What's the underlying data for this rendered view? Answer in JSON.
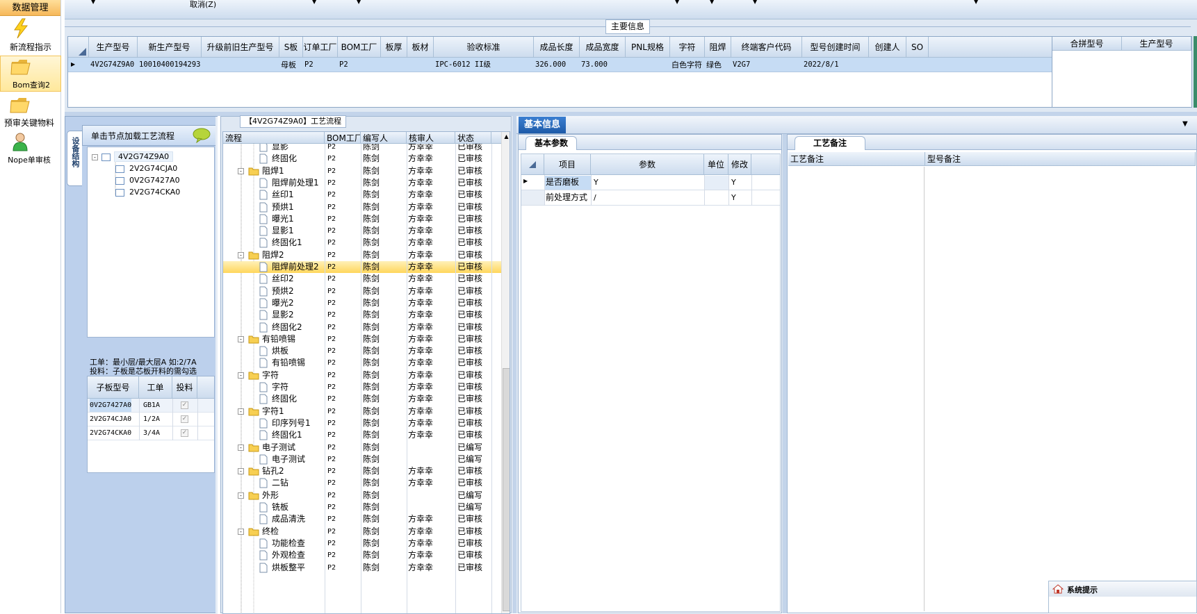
{
  "sidebar": {
    "header": "数据管理",
    "items": [
      {
        "label": "新流程指示",
        "icon": "lightning-icon"
      },
      {
        "label": "Bom查询2",
        "icon": "folder-open-icon"
      },
      {
        "label": "预审关键物料",
        "icon": "folder-open-icon"
      },
      {
        "label": "Nope单审核",
        "icon": "user-icon"
      }
    ]
  },
  "toolbar": {
    "cancel_label": "取消(Z)"
  },
  "main_info": {
    "title": "主要信息",
    "columns": [
      "生产型号",
      "新生产型号",
      "升级前旧生产型号",
      "S板",
      "订单工厂",
      "BOM工厂",
      "板厚",
      "板材",
      "验收标准",
      "成品长度",
      "成品宽度",
      "PNL规格",
      "字符",
      "阻焊",
      "终端客户代码",
      "型号创建时间",
      "创建人",
      "SO"
    ],
    "row": [
      "4V2G74Z9A0",
      "10010400194293",
      "",
      "母板",
      "P2",
      "P2",
      "",
      "",
      "IPC-6012 II级",
      "326.000",
      "73.000",
      "",
      "白色字符",
      "绿色",
      "V2G7",
      "2022/8/1",
      "",
      ""
    ],
    "side_columns": [
      "合拼型号",
      "生产型号"
    ]
  },
  "left_panel": {
    "vertical_tab": "设备结构",
    "hint": "单击节点加载工艺流程",
    "tree_root": "4V2G74Z9A0",
    "tree_children": [
      "2V2G74CJA0",
      "0V2G7427A0",
      "2V2G74CKA0"
    ],
    "note1": "工单：最小层/最大层A 如:2/7A",
    "note2": "投料：子板是芯板开料的需勾选",
    "sub_columns": [
      "子板型号",
      "工单",
      "投料"
    ],
    "sub_rows": [
      {
        "model": "0V2G7427A0",
        "order": "GB1A",
        "feed": "✓"
      },
      {
        "model": "2V2G74CJA0",
        "order": "1/2A",
        "feed": "✓"
      },
      {
        "model": "2V2G74CKA0",
        "order": "3/4A",
        "feed": "✓"
      }
    ]
  },
  "flow": {
    "title": "【4V2G74Z9A0】工艺流程",
    "columns": [
      "流程",
      "BOM工厂",
      "编写人",
      "核审人",
      "状态"
    ],
    "rows": [
      {
        "n": "显影",
        "f": "P2",
        "w": "陈剑",
        "r": "方幸幸",
        "s": "已审核",
        "t": "leaf"
      },
      {
        "n": "终固化",
        "f": "P2",
        "w": "陈剑",
        "r": "方幸幸",
        "s": "已审核",
        "t": "leaf"
      },
      {
        "n": "阻焊1",
        "f": "P2",
        "w": "陈剑",
        "r": "方幸幸",
        "s": "已审核",
        "t": "group"
      },
      {
        "n": "阻焊前处理1",
        "f": "P2",
        "w": "陈剑",
        "r": "方幸幸",
        "s": "已审核",
        "t": "leaf"
      },
      {
        "n": "丝印1",
        "f": "P2",
        "w": "陈剑",
        "r": "方幸幸",
        "s": "已审核",
        "t": "leaf"
      },
      {
        "n": "预烘1",
        "f": "P2",
        "w": "陈剑",
        "r": "方幸幸",
        "s": "已审核",
        "t": "leaf"
      },
      {
        "n": "曝光1",
        "f": "P2",
        "w": "陈剑",
        "r": "方幸幸",
        "s": "已审核",
        "t": "leaf"
      },
      {
        "n": "显影1",
        "f": "P2",
        "w": "陈剑",
        "r": "方幸幸",
        "s": "已审核",
        "t": "leaf"
      },
      {
        "n": "终固化1",
        "f": "P2",
        "w": "陈剑",
        "r": "方幸幸",
        "s": "已审核",
        "t": "leaf"
      },
      {
        "n": "阻焊2",
        "f": "P2",
        "w": "陈剑",
        "r": "方幸幸",
        "s": "已审核",
        "t": "group"
      },
      {
        "n": "阻焊前处理2",
        "f": "P2",
        "w": "陈剑",
        "r": "方幸幸",
        "s": "已审核",
        "t": "leaf",
        "sel": true
      },
      {
        "n": "丝印2",
        "f": "P2",
        "w": "陈剑",
        "r": "方幸幸",
        "s": "已审核",
        "t": "leaf"
      },
      {
        "n": "预烘2",
        "f": "P2",
        "w": "陈剑",
        "r": "方幸幸",
        "s": "已审核",
        "t": "leaf"
      },
      {
        "n": "曝光2",
        "f": "P2",
        "w": "陈剑",
        "r": "方幸幸",
        "s": "已审核",
        "t": "leaf"
      },
      {
        "n": "显影2",
        "f": "P2",
        "w": "陈剑",
        "r": "方幸幸",
        "s": "已审核",
        "t": "leaf"
      },
      {
        "n": "终固化2",
        "f": "P2",
        "w": "陈剑",
        "r": "方幸幸",
        "s": "已审核",
        "t": "leaf"
      },
      {
        "n": "有铅喷锡",
        "f": "P2",
        "w": "陈剑",
        "r": "方幸幸",
        "s": "已审核",
        "t": "group"
      },
      {
        "n": "烘板",
        "f": "P2",
        "w": "陈剑",
        "r": "方幸幸",
        "s": "已审核",
        "t": "leaf"
      },
      {
        "n": "有铅喷锡",
        "f": "P2",
        "w": "陈剑",
        "r": "方幸幸",
        "s": "已审核",
        "t": "leaf"
      },
      {
        "n": "字符",
        "f": "P2",
        "w": "陈剑",
        "r": "方幸幸",
        "s": "已审核",
        "t": "group"
      },
      {
        "n": "字符",
        "f": "P2",
        "w": "陈剑",
        "r": "方幸幸",
        "s": "已审核",
        "t": "leaf"
      },
      {
        "n": "终固化",
        "f": "P2",
        "w": "陈剑",
        "r": "方幸幸",
        "s": "已审核",
        "t": "leaf"
      },
      {
        "n": "字符1",
        "f": "P2",
        "w": "陈剑",
        "r": "方幸幸",
        "s": "已审核",
        "t": "group"
      },
      {
        "n": "印序列号1",
        "f": "P2",
        "w": "陈剑",
        "r": "方幸幸",
        "s": "已审核",
        "t": "leaf"
      },
      {
        "n": "终固化1",
        "f": "P2",
        "w": "陈剑",
        "r": "方幸幸",
        "s": "已审核",
        "t": "leaf"
      },
      {
        "n": "电子测试",
        "f": "P2",
        "w": "陈剑",
        "r": "",
        "s": "已编写",
        "t": "group"
      },
      {
        "n": "电子测试",
        "f": "P2",
        "w": "陈剑",
        "r": "",
        "s": "已编写",
        "t": "leaf"
      },
      {
        "n": "钻孔2",
        "f": "P2",
        "w": "陈剑",
        "r": "方幸幸",
        "s": "已审核",
        "t": "group"
      },
      {
        "n": "二钻",
        "f": "P2",
        "w": "陈剑",
        "r": "方幸幸",
        "s": "已审核",
        "t": "leaf"
      },
      {
        "n": "外形",
        "f": "P2",
        "w": "陈剑",
        "r": "",
        "s": "已编写",
        "t": "group"
      },
      {
        "n": "铣板",
        "f": "P2",
        "w": "陈剑",
        "r": "",
        "s": "已编写",
        "t": "leaf"
      },
      {
        "n": "成品清洗",
        "f": "P2",
        "w": "陈剑",
        "r": "方幸幸",
        "s": "已审核",
        "t": "leaf"
      },
      {
        "n": "终检",
        "f": "P2",
        "w": "陈剑",
        "r": "方幸幸",
        "s": "已审核",
        "t": "group"
      },
      {
        "n": "功能检查",
        "f": "P2",
        "w": "陈剑",
        "r": "方幸幸",
        "s": "已审核",
        "t": "leaf"
      },
      {
        "n": "外观检查",
        "f": "P2",
        "w": "陈剑",
        "r": "方幸幸",
        "s": "已审核",
        "t": "leaf"
      },
      {
        "n": "烘板整平",
        "f": "P2",
        "w": "陈剑",
        "r": "方幸幸",
        "s": "已审核",
        "t": "leaf"
      }
    ]
  },
  "basic_info": {
    "tab": "基本信息",
    "params_tab": "基本参数",
    "columns": [
      "项目",
      "参数",
      "单位",
      "修改"
    ],
    "rows": [
      {
        "item": "是否磨板",
        "param": "Y",
        "unit": "",
        "mod": "Y"
      },
      {
        "item": "前处理方式",
        "param": "/",
        "unit": "",
        "mod": "Y"
      }
    ]
  },
  "process_notes": {
    "tab": "工艺备注",
    "col1": "工艺备注",
    "col2": "型号备注"
  },
  "system_tip": {
    "title": "系统提示"
  }
}
